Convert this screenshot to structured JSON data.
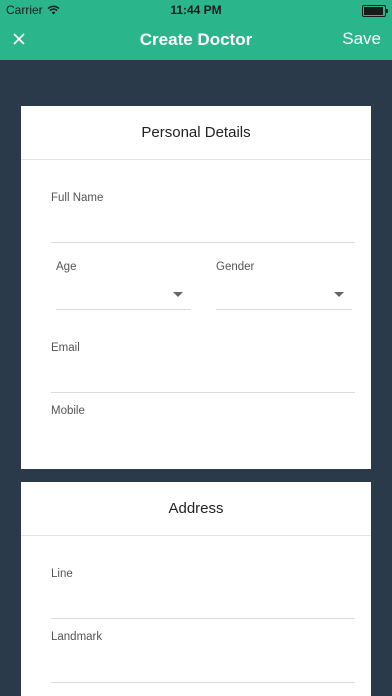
{
  "status_bar": {
    "carrier": "Carrier",
    "time": "11:44 PM",
    "battery_level": 0.95
  },
  "nav": {
    "title": "Create Doctor",
    "save_label": "Save"
  },
  "personal": {
    "title": "Personal Details",
    "full_name_label": "Full Name",
    "age_label": "Age",
    "gender_label": "Gender",
    "email_label": "Email",
    "mobile_label": "Mobile"
  },
  "address": {
    "title": "Address",
    "line_label": "Line",
    "landmark_label": "Landmark"
  }
}
